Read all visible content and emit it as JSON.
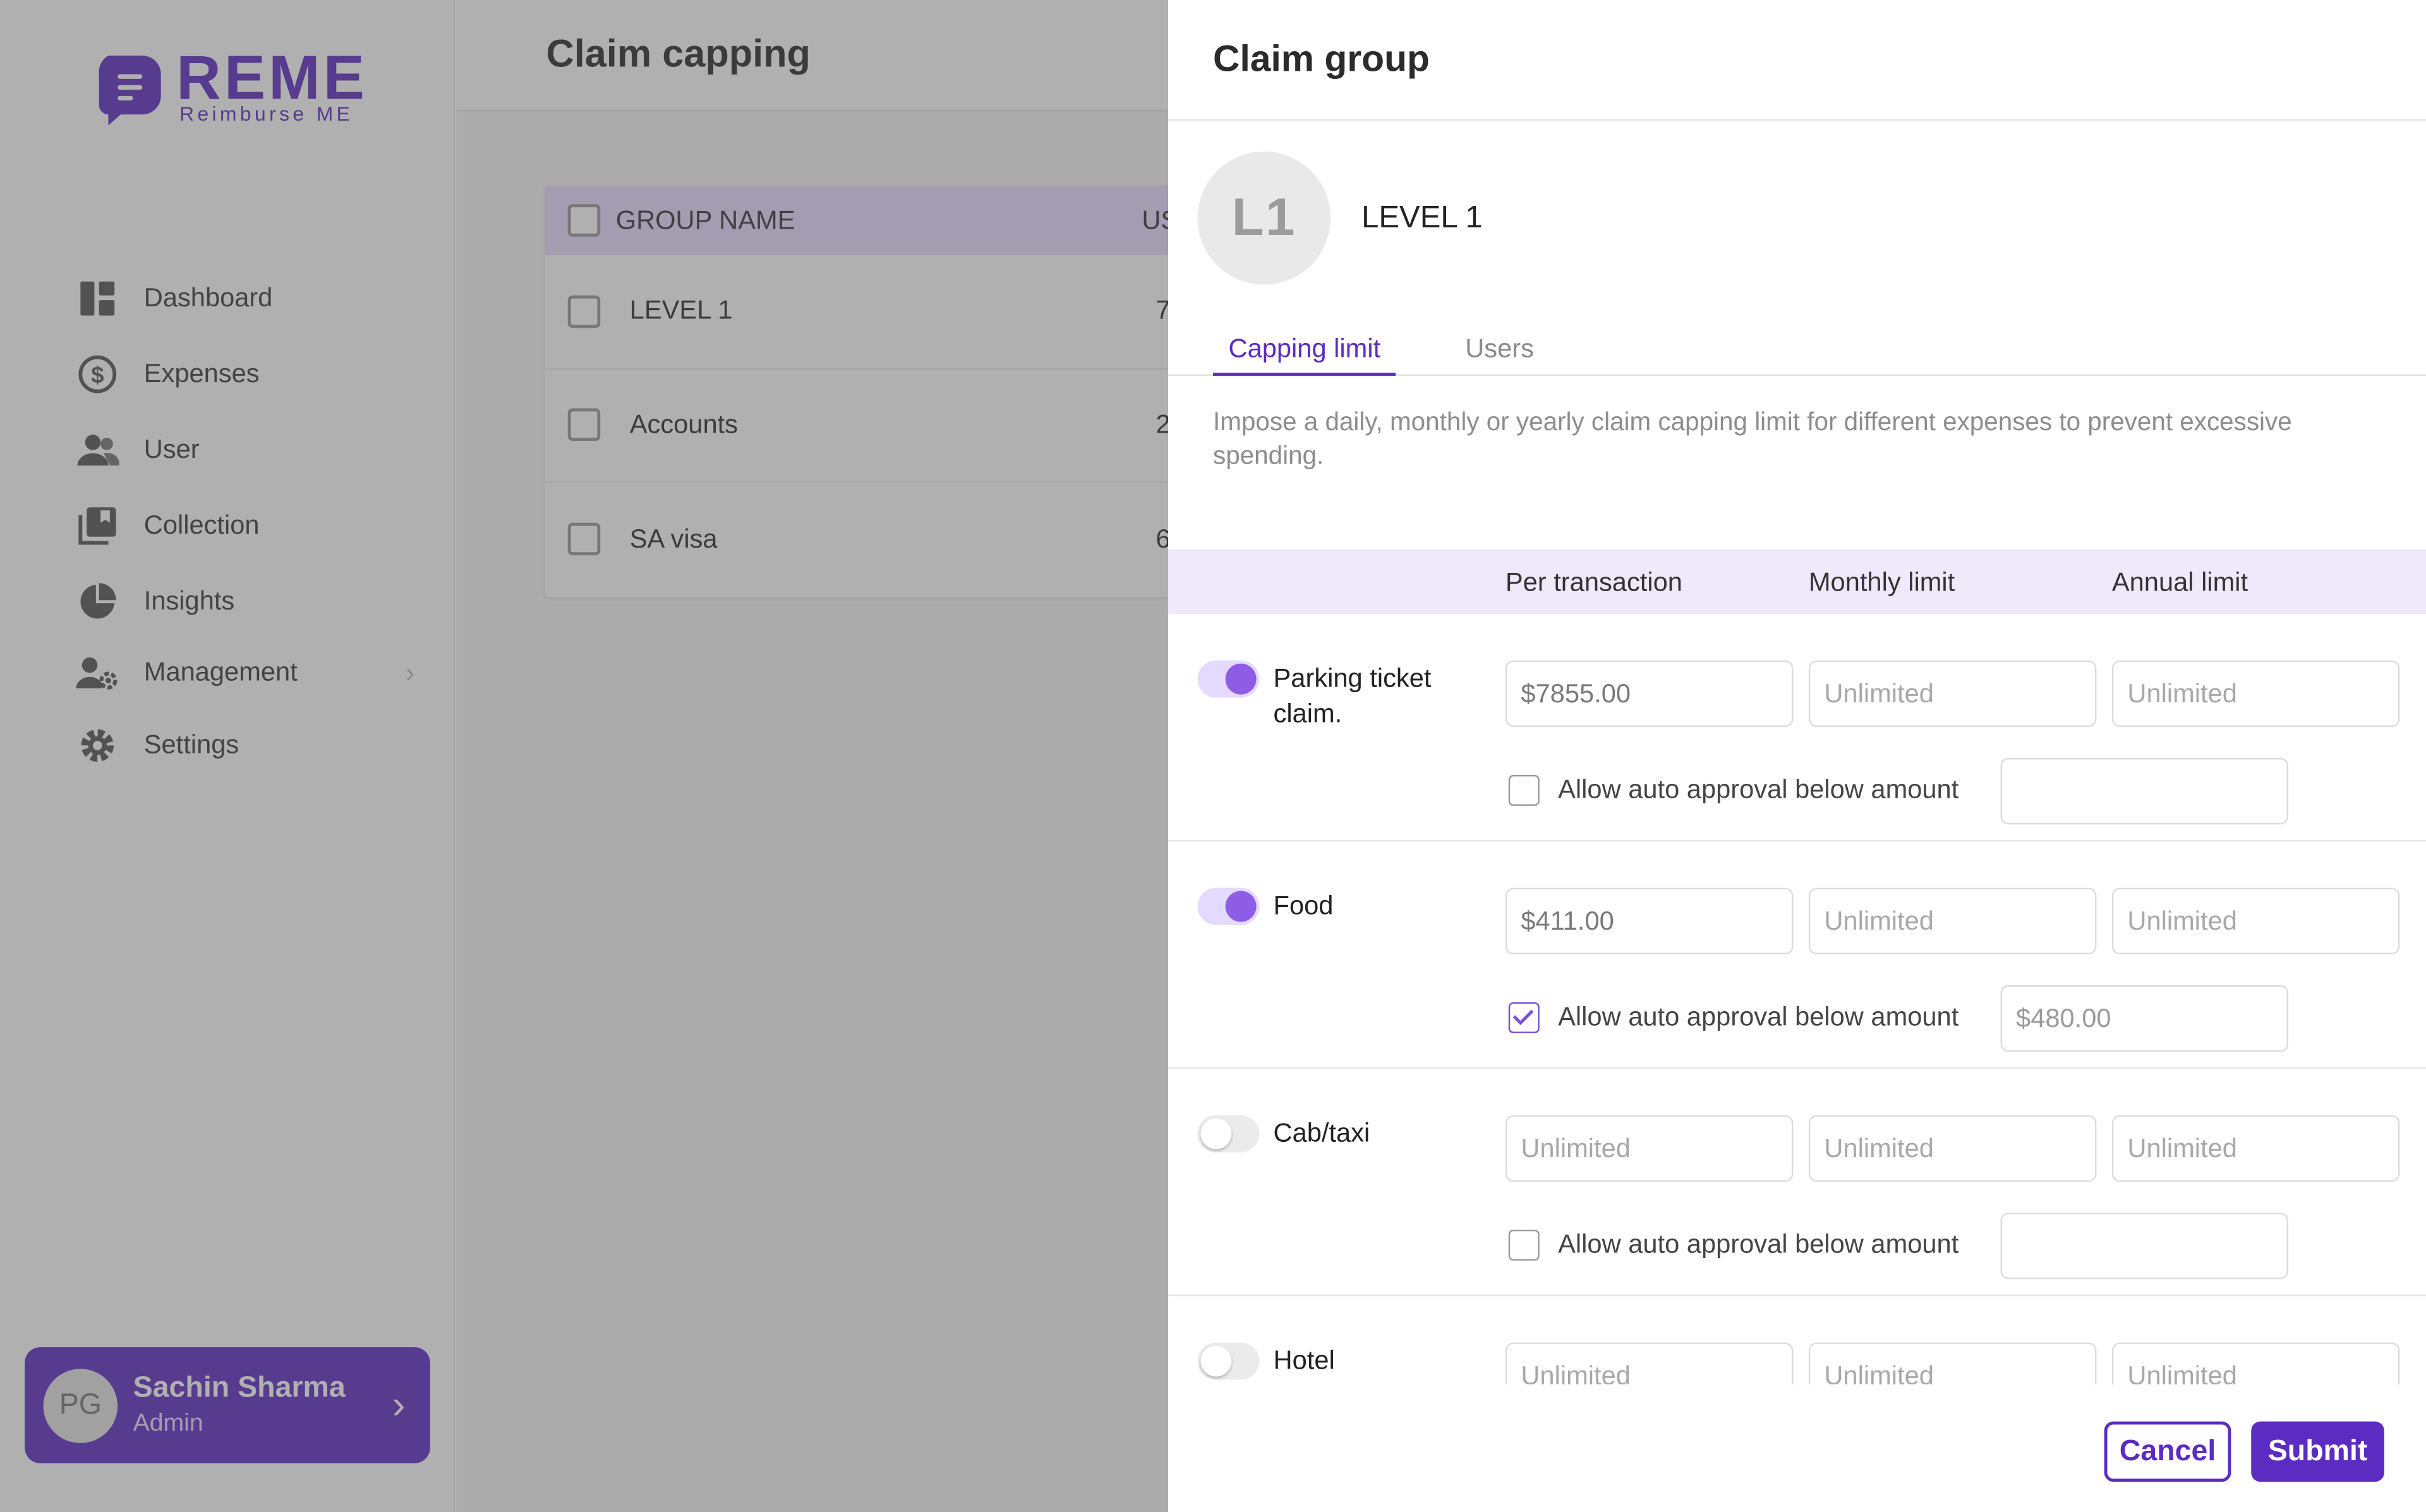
{
  "app": {
    "logo_word": "REME",
    "logo_sub": "Reimburse ME",
    "brand_color": "#5b2bc2"
  },
  "sidebar": {
    "items": [
      {
        "label": "Dashboard",
        "icon": "dashboard-icon"
      },
      {
        "label": "Expenses",
        "icon": "expenses-icon"
      },
      {
        "label": "User",
        "icon": "users-icon"
      },
      {
        "label": "Collection",
        "icon": "collection-icon"
      },
      {
        "label": "Insights",
        "icon": "pie-chart-icon"
      },
      {
        "label": "Management",
        "icon": "user-gear-icon",
        "has_submenu": true
      },
      {
        "label": "Settings",
        "icon": "gear-icon"
      }
    ],
    "user": {
      "initials": "PG",
      "name": "Sachin Sharma",
      "role": "Admin"
    }
  },
  "main": {
    "title": "Claim capping",
    "table": {
      "header": {
        "group_name": "GROUP NAME",
        "users": "US"
      },
      "rows": [
        {
          "name": "LEVEL 1",
          "count": "7"
        },
        {
          "name": "Accounts",
          "count": "2"
        },
        {
          "name": "SA visa",
          "count": "6"
        }
      ]
    }
  },
  "drawer": {
    "title": "Claim group",
    "group": {
      "initials": "L1",
      "name": "LEVEL 1"
    },
    "tabs": [
      {
        "label": "Capping limit",
        "active": true
      },
      {
        "label": "Users",
        "active": false
      }
    ],
    "description": "Impose a daily, monthly or yearly claim capping limit for different expenses to prevent excessive spending.",
    "columns": {
      "per_transaction": "Per transaction",
      "monthly": "Monthly limit",
      "annual": "Annual limit"
    },
    "auto_label": "Allow auto approval below amount",
    "expenses": [
      {
        "name": "Parking ticket claim.",
        "enabled": true,
        "per_transaction": "$7855.00",
        "monthly": "Unlimited",
        "annual": "Unlimited",
        "auto_checked": false,
        "auto_value": ""
      },
      {
        "name": "Food",
        "enabled": true,
        "per_transaction": "$411.00",
        "monthly": "Unlimited",
        "annual": "Unlimited",
        "auto_checked": true,
        "auto_value": "$480.00"
      },
      {
        "name": "Cab/taxi",
        "enabled": false,
        "per_transaction": "Unlimited",
        "monthly": "Unlimited",
        "annual": "Unlimited",
        "auto_checked": false,
        "auto_value": ""
      },
      {
        "name": "Hotel",
        "enabled": false,
        "per_transaction": "Unlimited",
        "monthly": "Unlimited",
        "annual": "Unlimited",
        "auto_checked": false,
        "auto_value": ""
      }
    ],
    "buttons": {
      "cancel": "Cancel",
      "submit": "Submit"
    }
  }
}
